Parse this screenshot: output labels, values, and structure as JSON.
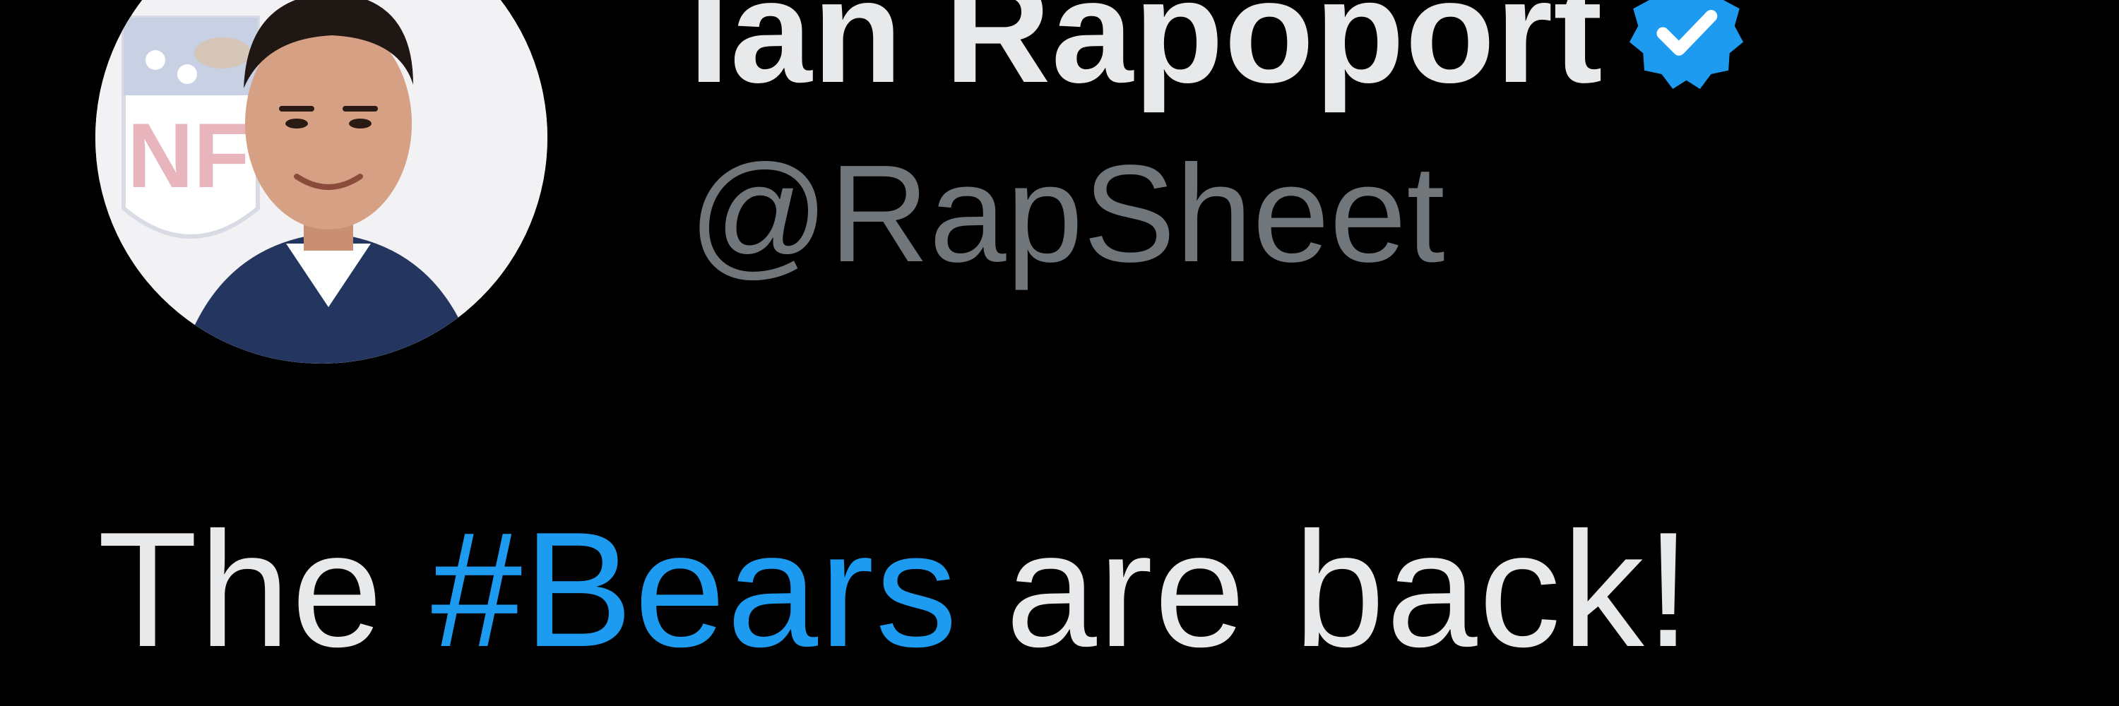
{
  "tweet": {
    "author": {
      "display_name": "Ian Rapoport",
      "handle": "@RapSheet",
      "verified": true,
      "avatar_icon": "profile-photo"
    },
    "text": {
      "prefix": "The ",
      "hashtag": "#Bears",
      "suffix": " are back!"
    }
  },
  "colors": {
    "background": "#000000",
    "primary_text": "#e7e9ea",
    "secondary_text": "#71767b",
    "accent": "#1d9bf0"
  }
}
